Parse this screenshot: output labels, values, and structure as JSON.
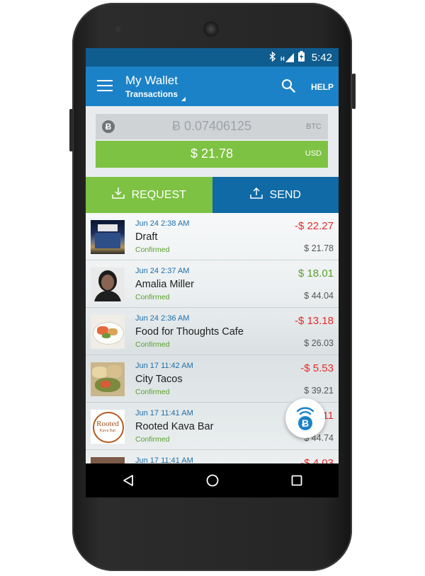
{
  "status_bar": {
    "icons": [
      "bluetooth-icon",
      "signal-h-icon",
      "battery-charging-icon"
    ],
    "signal_label": "H",
    "time": "5:42"
  },
  "app_bar": {
    "title": "My Wallet",
    "subtitle": "Transactions",
    "help_label": "HELP",
    "icons": [
      "menu-icon",
      "search-icon"
    ]
  },
  "balance": {
    "btc_amount": "Ƀ 0.07406125",
    "btc_currency": "BTC",
    "usd_amount": "$ 21.78",
    "usd_currency": "USD"
  },
  "actions": {
    "request_label": "REQUEST",
    "send_label": "SEND"
  },
  "transactions": [
    {
      "date": "Jun 24 2:38 AM",
      "name": "Draft",
      "status": "Confirmed",
      "amount": "-$ 22.27",
      "fiat": "$ 21.78",
      "direction": "out"
    },
    {
      "date": "Jun 24 2:37 AM",
      "name": "Amalia Miller",
      "status": "Confirmed",
      "amount": "$ 18.01",
      "fiat": "$ 44.04",
      "direction": "in"
    },
    {
      "date": "Jun 24 2:36 AM",
      "name": "Food for Thoughts Cafe",
      "status": "Confirmed",
      "amount": "-$ 13.18",
      "fiat": "$ 26.03",
      "direction": "out"
    },
    {
      "date": "Jun 17 11:42 AM",
      "name": "City Tacos",
      "status": "Confirmed",
      "amount": "-$ 5.53",
      "fiat": "$ 39.21",
      "direction": "out"
    },
    {
      "date": "Jun 17 11:41 AM",
      "name": "Rooted Kava Bar",
      "status": "Confirmed",
      "amount": "11",
      "fiat": "$ 44.74",
      "direction": "out"
    },
    {
      "date": "Jun 17 11:41 AM",
      "name": "",
      "status": "",
      "amount": "-$ 4.03",
      "fiat": "",
      "direction": "out"
    }
  ],
  "thumb_texts": {
    "rooted_line1": "Rooted",
    "rooted_line2": "Kava Bar"
  },
  "colors": {
    "app_bar": "#1c82c7",
    "status_bar": "#0f5c8f",
    "green": "#7dc242",
    "send_blue": "#0f6aa6",
    "negative": "#e52a2a",
    "positive": "#5aa02c"
  },
  "nav": {
    "icons": [
      "back-icon",
      "home-icon",
      "recents-icon"
    ]
  },
  "fab": {
    "icon": "bitcoin-wireless-icon"
  }
}
